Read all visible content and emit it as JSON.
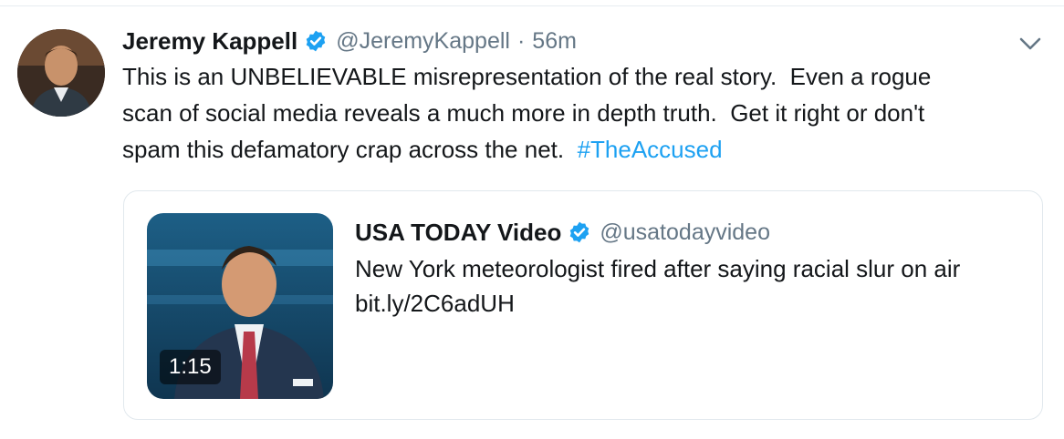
{
  "tweet": {
    "author_name": "Jeremy Kappell",
    "handle": "@JeremyKappell",
    "separator": "·",
    "time": "56m",
    "text_lines": [
      "This is an UNBELIEVABLE misrepresentation of the real story.  Even a rogue",
      "scan of social media reveals a much more in depth truth.  Get it right or don't",
      "spam this defamatory crap across the net.  "
    ],
    "hashtag": "#TheAccused"
  },
  "quote": {
    "author_name": "USA TODAY Video",
    "handle": "@usatodayvideo",
    "text": "New York meteorologist fired after saying racial slur on air",
    "link": "bit.ly/2C6adUH",
    "video_duration": "1:15"
  },
  "icons": {
    "verified": "verified-badge-icon",
    "more": "chevron-down-icon"
  },
  "colors": {
    "text": "#14171a",
    "secondary": "#657786",
    "link": "#1da1f2",
    "verified": "#1da1f2",
    "border": "#e1e8ed"
  }
}
